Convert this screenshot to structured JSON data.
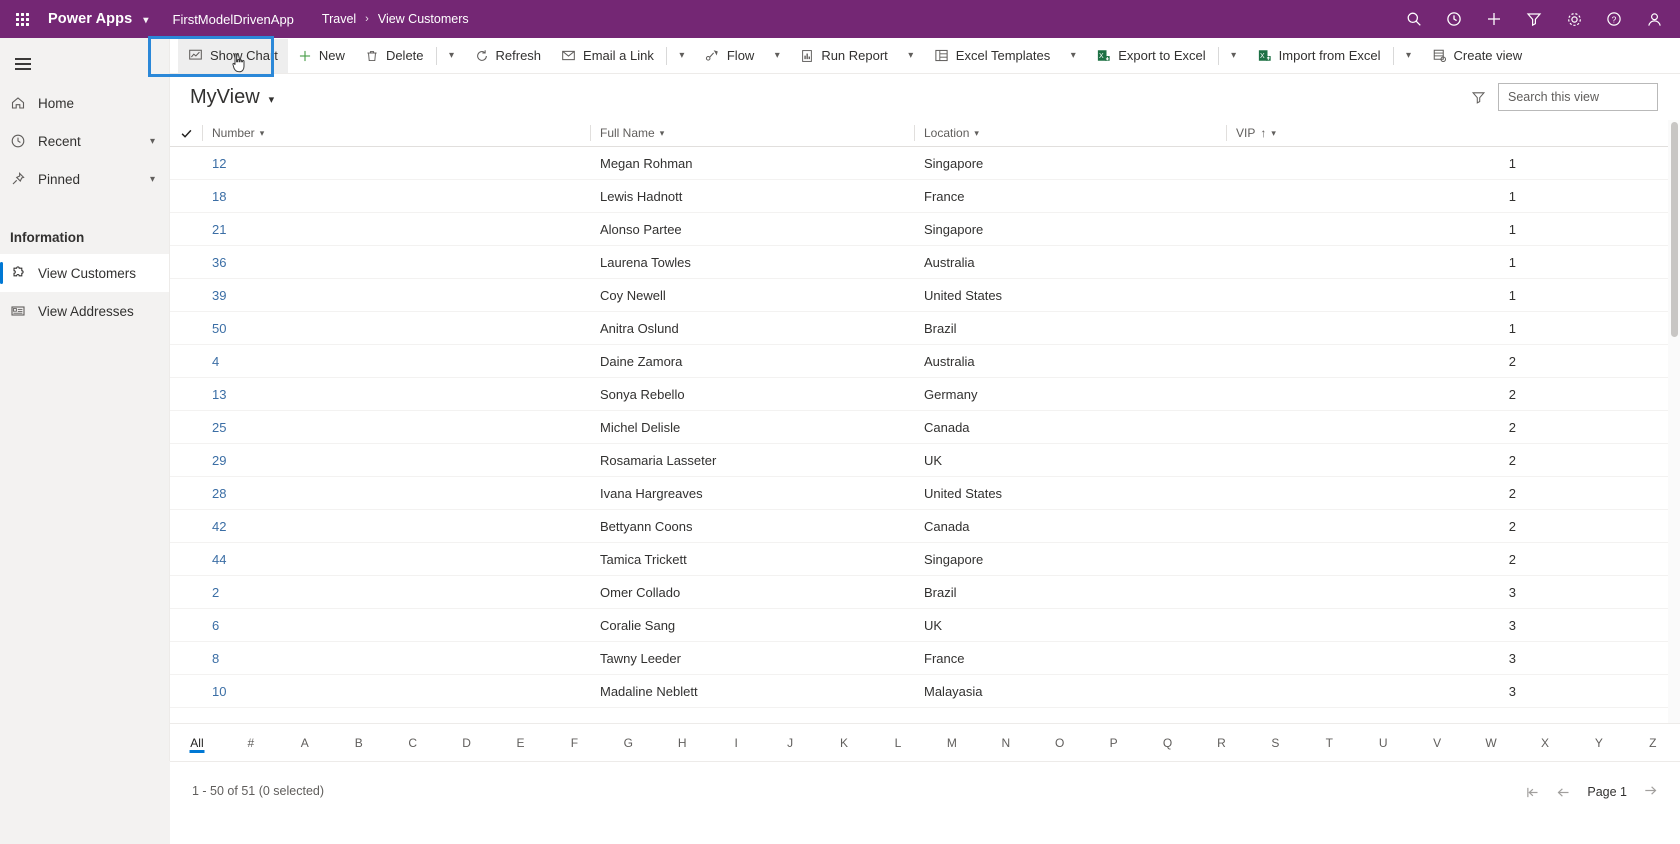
{
  "topbar": {
    "waffle_label": "App launcher",
    "brand": "Power Apps",
    "app_name": "FirstModelDrivenApp",
    "breadcrumbs": [
      "Travel",
      "View Customers"
    ],
    "breadcrumb_separator": "›",
    "actions": [
      "search-icon",
      "clock-refresh-icon",
      "plus-icon",
      "filter-icon",
      "gear-icon",
      "help-icon",
      "account-icon"
    ],
    "accent_color": "#742774"
  },
  "sidebar": {
    "hamburger_label": "Site map",
    "items": [
      {
        "label": "Home",
        "icon": "home-icon",
        "expandable": false
      },
      {
        "label": "Recent",
        "icon": "clock-icon",
        "expandable": true
      },
      {
        "label": "Pinned",
        "icon": "pin-icon",
        "expandable": true
      }
    ],
    "group_title": "Information",
    "group_items": [
      {
        "label": "View Customers",
        "icon": "puzzle-icon",
        "selected": true
      },
      {
        "label": "View Addresses",
        "icon": "card-icon",
        "selected": false
      }
    ],
    "selected_accent": "#0078d4"
  },
  "commandbar": {
    "items": [
      {
        "label": "Show Chart",
        "icon": "chart-icon",
        "caret": false,
        "focused": true
      },
      {
        "label": "New",
        "icon": "plus-icon",
        "caret": false
      },
      {
        "label": "Delete",
        "icon": "trash-icon",
        "caret": true,
        "sep_before_caret": true
      },
      {
        "label": "Refresh",
        "icon": "refresh-icon",
        "caret": false
      },
      {
        "label": "Email a Link",
        "icon": "email-link-icon",
        "caret": true,
        "sep_before_caret": true
      },
      {
        "label": "Flow",
        "icon": "flow-icon",
        "caret": true
      },
      {
        "label": "Run Report",
        "icon": "report-icon",
        "caret": true
      },
      {
        "label": "Excel Templates",
        "icon": "excel-template-icon",
        "caret": true
      },
      {
        "label": "Export to Excel",
        "icon": "excel-export-icon",
        "caret": true,
        "sep_before_caret": true
      },
      {
        "label": "Import from Excel",
        "icon": "excel-import-icon",
        "caret": true,
        "sep_before_caret": true
      },
      {
        "label": "Create view",
        "icon": "create-view-icon",
        "caret": false
      }
    ],
    "focus_ring_color": "#2b88d8"
  },
  "viewheader": {
    "view_name": "MyView",
    "filter_icon": "filter-icon",
    "search_placeholder": "Search this view",
    "search_value": "",
    "search_icon": "search-icon"
  },
  "grid": {
    "select_all_icon": "checkmark-icon",
    "columns": [
      {
        "label": "Number",
        "sorted": false,
        "sort_dir": ""
      },
      {
        "label": "Full Name",
        "sorted": false,
        "sort_dir": ""
      },
      {
        "label": "Location",
        "sorted": false,
        "sort_dir": ""
      },
      {
        "label": "VIP",
        "sorted": true,
        "sort_dir": "↑"
      }
    ],
    "rows": [
      {
        "number": "12",
        "name": "Megan Rohman",
        "location": "Singapore",
        "vip": "1"
      },
      {
        "number": "18",
        "name": "Lewis Hadnott",
        "location": "France",
        "vip": "1"
      },
      {
        "number": "21",
        "name": "Alonso Partee",
        "location": "Singapore",
        "vip": "1"
      },
      {
        "number": "36",
        "name": "Laurena Towles",
        "location": "Australia",
        "vip": "1"
      },
      {
        "number": "39",
        "name": "Coy Newell",
        "location": "United States",
        "vip": "1"
      },
      {
        "number": "50",
        "name": "Anitra Oslund",
        "location": "Brazil",
        "vip": "1"
      },
      {
        "number": "4",
        "name": "Daine Zamora",
        "location": "Australia",
        "vip": "2"
      },
      {
        "number": "13",
        "name": "Sonya Rebello",
        "location": "Germany",
        "vip": "2"
      },
      {
        "number": "25",
        "name": "Michel Delisle",
        "location": "Canada",
        "vip": "2"
      },
      {
        "number": "29",
        "name": "Rosamaria Lasseter",
        "location": "UK",
        "vip": "2"
      },
      {
        "number": "28",
        "name": "Ivana Hargreaves",
        "location": "United States",
        "vip": "2"
      },
      {
        "number": "42",
        "name": "Bettyann Coons",
        "location": "Canada",
        "vip": "2"
      },
      {
        "number": "44",
        "name": "Tamica Trickett",
        "location": "Singapore",
        "vip": "2"
      },
      {
        "number": "2",
        "name": "Omer Collado",
        "location": "Brazil",
        "vip": "3"
      },
      {
        "number": "6",
        "name": "Coralie Sang",
        "location": "UK",
        "vip": "3"
      },
      {
        "number": "8",
        "name": "Tawny Leeder",
        "location": "France",
        "vip": "3"
      },
      {
        "number": "10",
        "name": "Madaline Neblett",
        "location": "Malayasia",
        "vip": "3"
      }
    ]
  },
  "alphabar": {
    "selected": "All",
    "letters": [
      "All",
      "#",
      "A",
      "B",
      "C",
      "D",
      "E",
      "F",
      "G",
      "H",
      "I",
      "J",
      "K",
      "L",
      "M",
      "N",
      "O",
      "P",
      "Q",
      "R",
      "S",
      "T",
      "U",
      "V",
      "W",
      "X",
      "Y",
      "Z"
    ]
  },
  "footer": {
    "record_count": "1 - 50 of 51 (0 selected)",
    "first_page_icon": "first-page-icon",
    "prev_page_icon": "prev-page-icon",
    "page_label": "Page 1",
    "next_page_icon": "next-page-icon"
  }
}
